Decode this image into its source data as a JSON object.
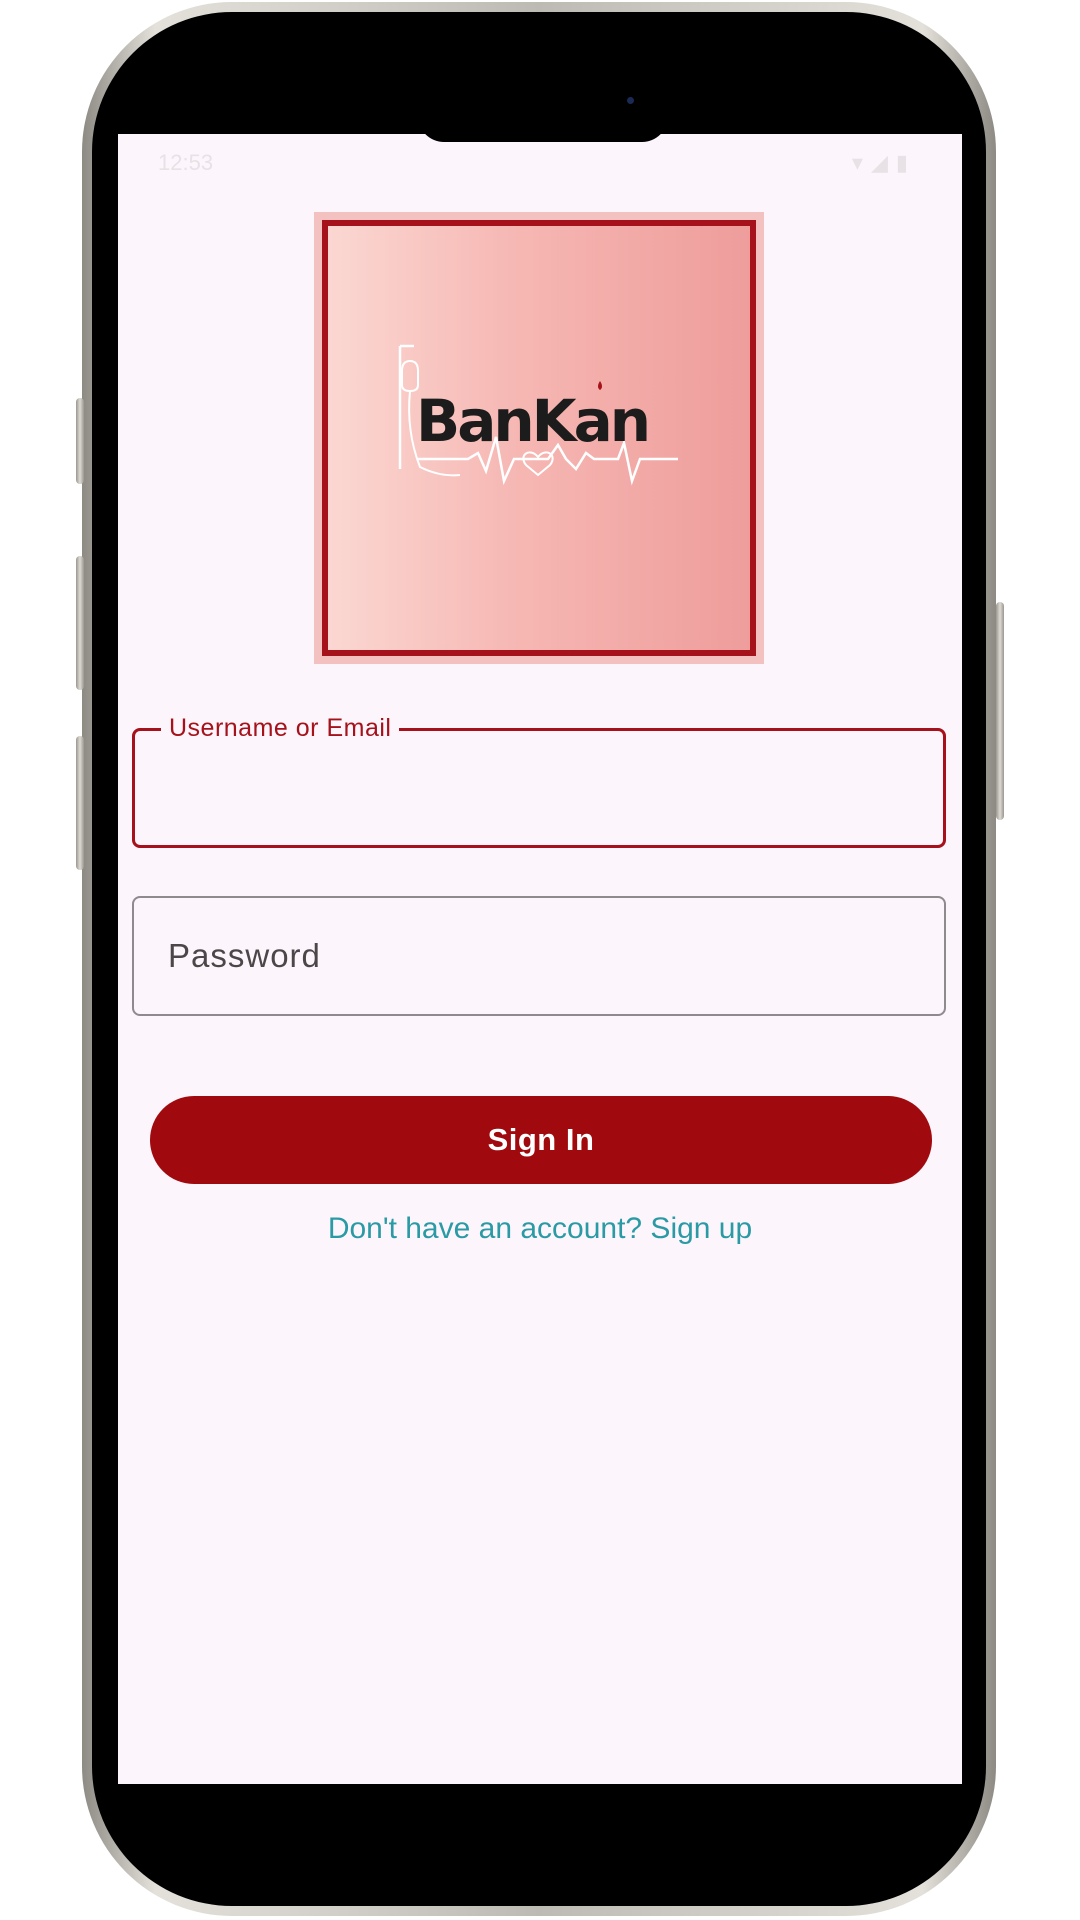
{
  "status_bar": {
    "time": "12:53",
    "right_icons": "▾◢▮"
  },
  "logo": {
    "text_part1": "Ban",
    "text_part2": "Kan",
    "colors": {
      "dark": "#1c1c1c",
      "red": "#a5121b",
      "line": "#ffffff"
    }
  },
  "login_form": {
    "username_label": "Username or Email",
    "username_value": "",
    "password_placeholder": "Password",
    "password_value": "",
    "sign_in_label": "Sign In",
    "signup_prompt": "Don't have an account? Sign up"
  },
  "theme": {
    "primary": "#a00a0e",
    "background": "#fcf5fb",
    "link": "#2a9aa5"
  }
}
